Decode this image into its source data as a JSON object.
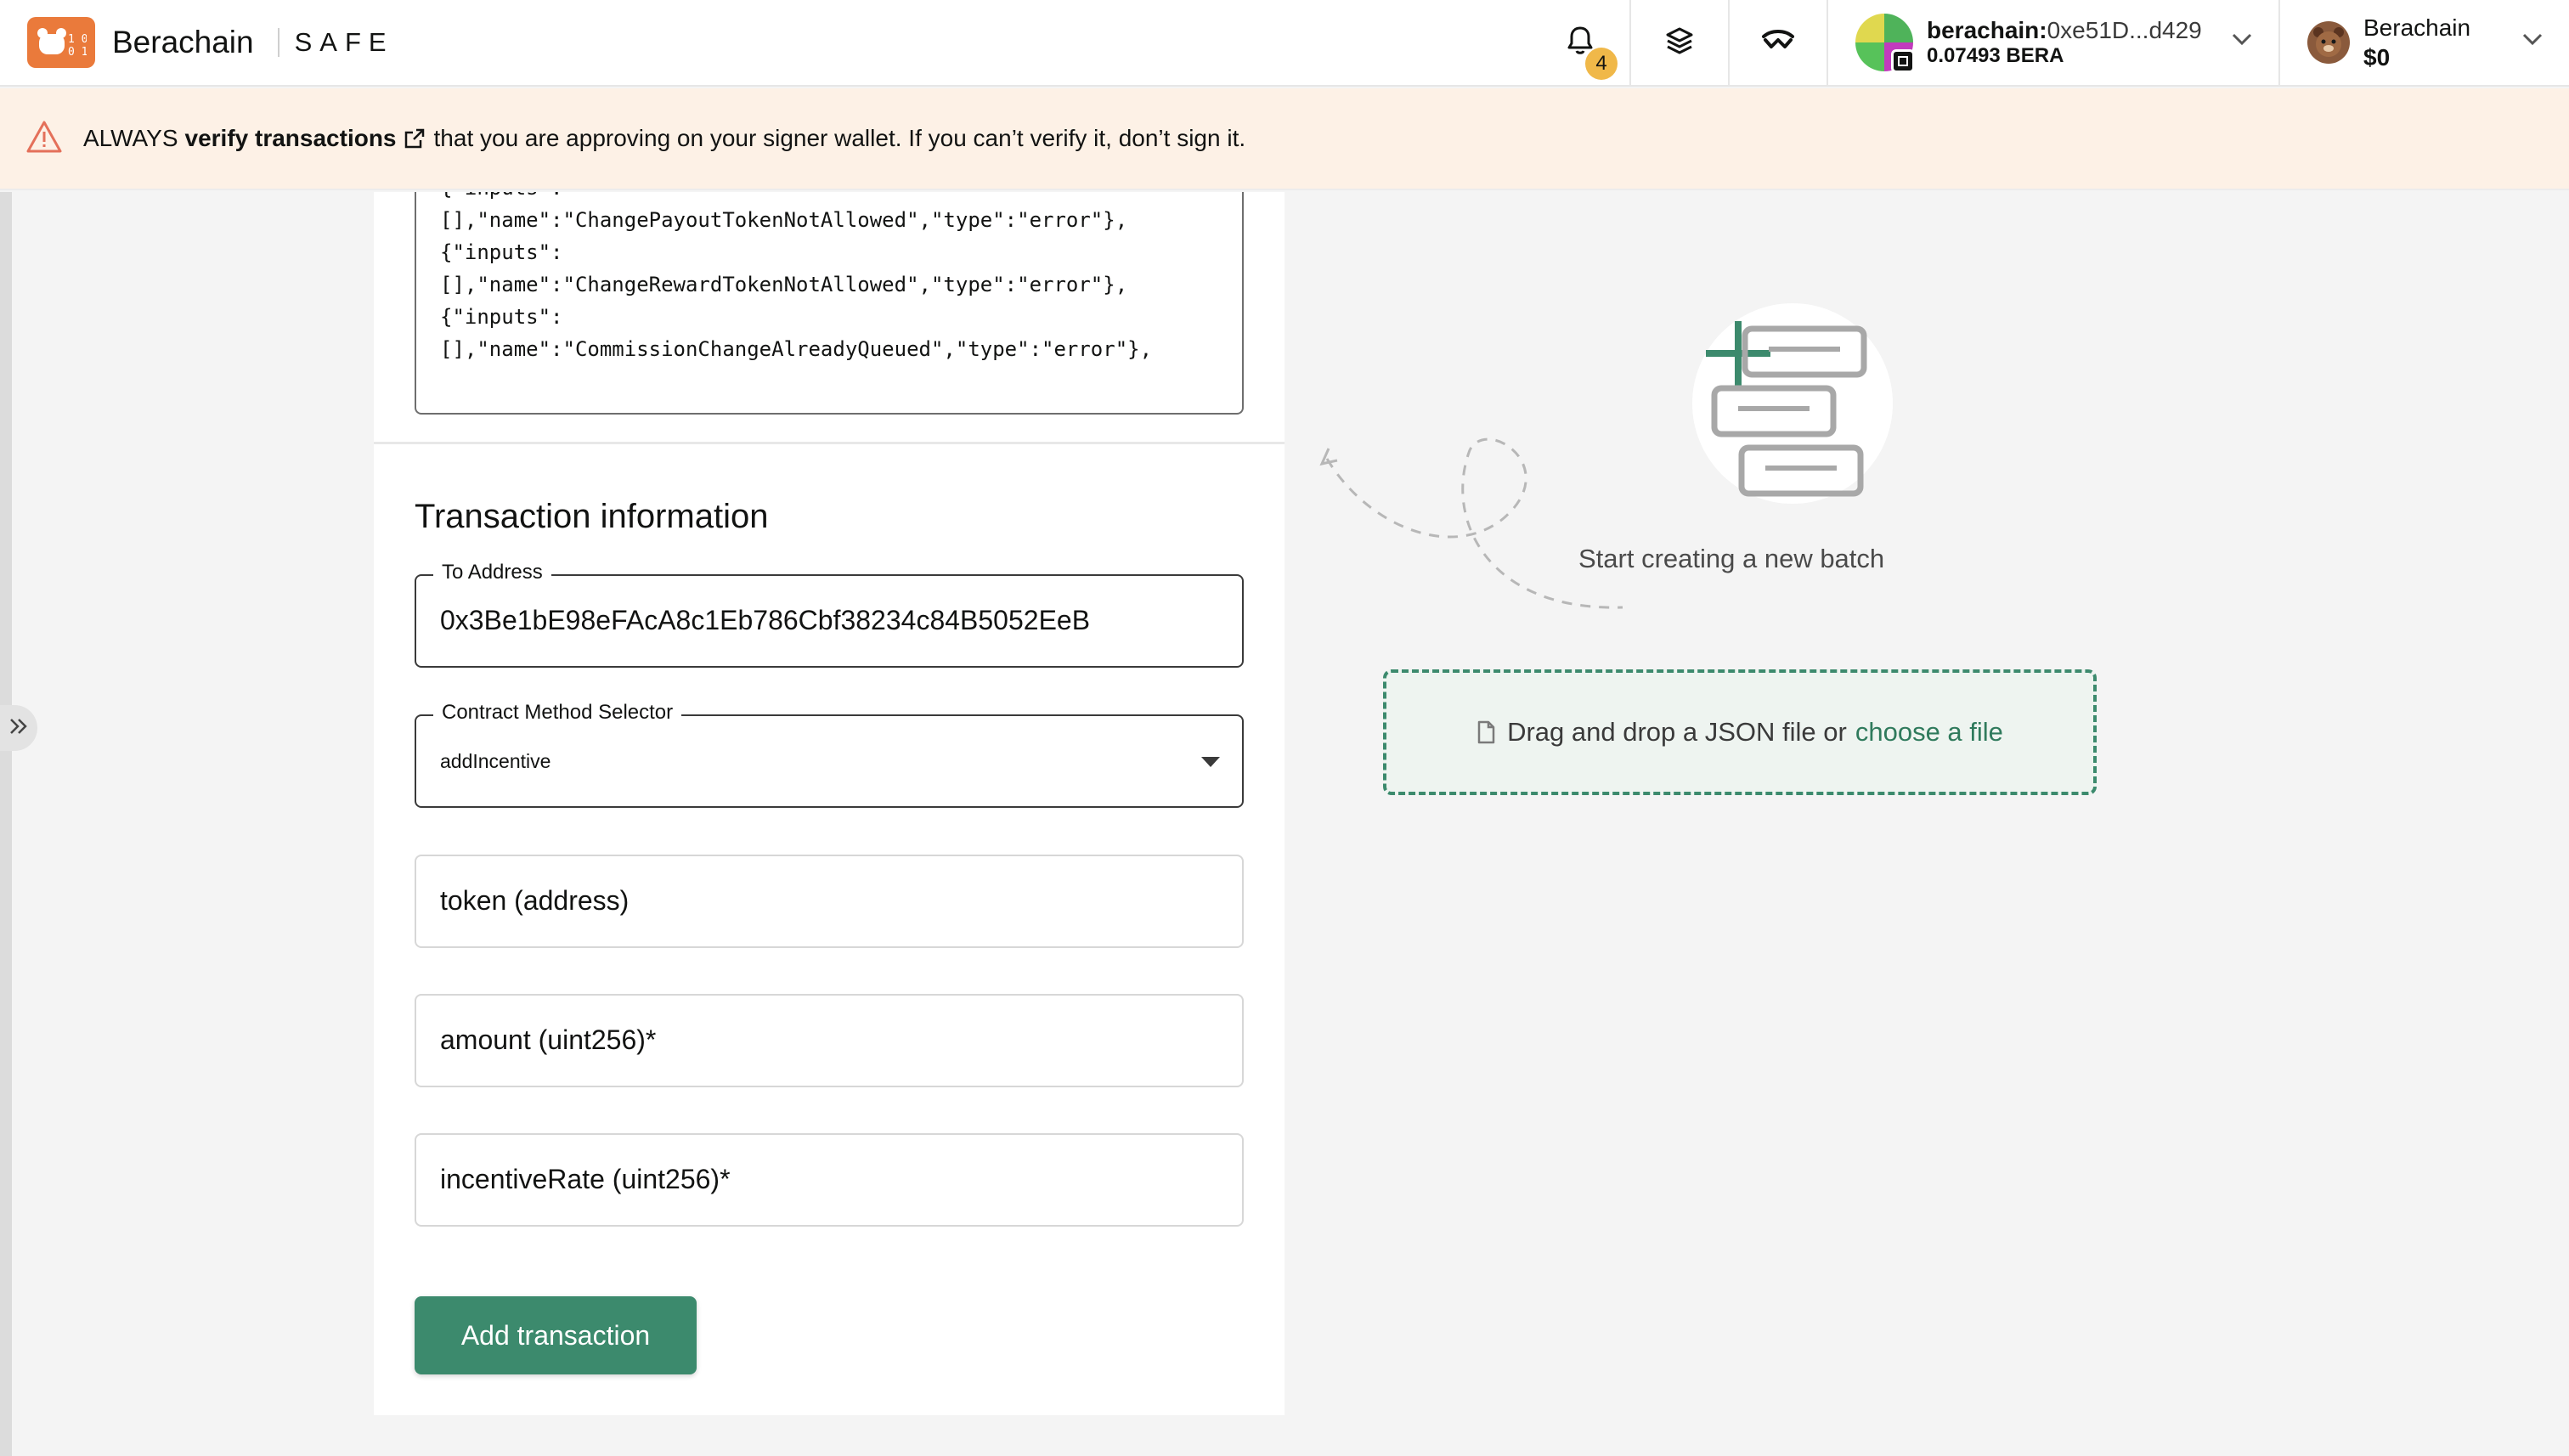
{
  "header": {
    "brand_name": "Berachain",
    "brand_product": "SAFE",
    "notifications_count": "4",
    "account": {
      "network_prefix": "berachain:",
      "address": "0xe51D...d429",
      "balance": "0.07493 BERA"
    },
    "network": {
      "name": "Berachain",
      "balance": "$0"
    }
  },
  "banner": {
    "prefix": "ALWAYS",
    "link_text": "verify transactions",
    "suffix": "that you are approving on your signer wallet. If you can’t verify it, don’t sign it."
  },
  "abi": {
    "text": "{\"inputs\":\n[],\"name\":\"ChangePayoutTokenNotAllowed\",\"type\":\"error\"},\n{\"inputs\":\n[],\"name\":\"ChangeRewardTokenNotAllowed\",\"type\":\"error\"},\n{\"inputs\":\n[],\"name\":\"CommissionChangeAlreadyQueued\",\"type\":\"error\"},"
  },
  "form": {
    "section_title": "Transaction information",
    "to_address": {
      "label": "To Address",
      "value": "0x3Be1bE98eFAcA8c1Eb786Cbf38234c84B5052EeB"
    },
    "method_selector": {
      "label": "Contract Method Selector",
      "value": "addIncentive"
    },
    "params": [
      {
        "placeholder": "token (address)"
      },
      {
        "placeholder": "amount (uint256)*"
      },
      {
        "placeholder": "incentiveRate (uint256)*"
      }
    ],
    "submit_label": "Add transaction"
  },
  "batch": {
    "empty_hint": "Start creating a new batch",
    "drop_text": "Drag and drop a JSON file or",
    "choose_link": "choose a file"
  },
  "colors": {
    "accent": "#3c8a6d",
    "brand": "#ea7a3b",
    "banner_bg": "#fdf1e6",
    "warning_icon": "#e4705a"
  }
}
